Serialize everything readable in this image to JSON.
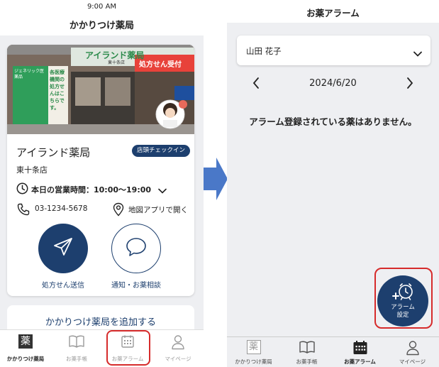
{
  "left_screen": {
    "status_time": "9:00 AM",
    "title": "かかりつけ薬局",
    "pharmacy": {
      "name": "アイランド薬局",
      "checkin_label": "店頭チェックイン",
      "branch": "東十条店",
      "hours": "本日の営業時間：10:00〜19:00",
      "phone": "03-1234-5678",
      "map_link": "地図アプリで開く",
      "send_label": "処方せん送信",
      "consult_label": "通知・お薬相談"
    },
    "storefront_sign": {
      "store": "アイランド薬局",
      "branch_small": "東十条店",
      "reception": "処方せん受付",
      "window_1": "ジェネリック医薬品",
      "window_2": "各医療機関の処方せんはこちらです。"
    },
    "add_pharmacy_label": "かかりつけ薬局を追加する",
    "tabs": [
      {
        "label": "かかりつけ薬局",
        "glyph": "薬",
        "active": true
      },
      {
        "label": "お薬手帳",
        "active": false
      },
      {
        "label": "お薬アラーム",
        "active": false
      },
      {
        "label": "マイページ",
        "active": false
      }
    ]
  },
  "right_screen": {
    "title": "お薬アラーム",
    "person": "山田 花子",
    "date": "2024/6/20",
    "empty_message": "アラーム登録されている薬はありません。",
    "alarm_button_label": [
      "アラーム",
      "設定"
    ],
    "tabs": [
      {
        "label": "かかりつけ薬局",
        "glyph": "薬",
        "active": false
      },
      {
        "label": "お薬手帳",
        "active": false
      },
      {
        "label": "お薬アラーム",
        "active": true
      },
      {
        "label": "マイページ",
        "active": false
      }
    ]
  },
  "colors": {
    "brand_navy": "#1d3f6e",
    "highlight_red": "#d62b2b",
    "arrow_blue": "#4a78c8",
    "background_gray": "#eeeff2"
  }
}
